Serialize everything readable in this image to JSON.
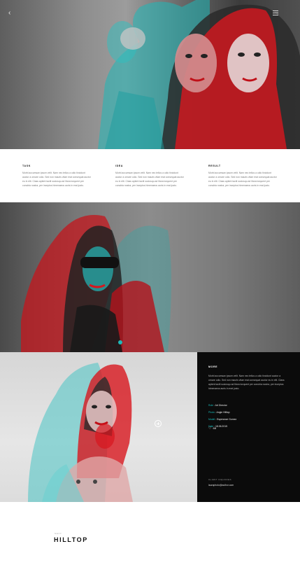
{
  "columns": [
    {
      "title": "TASK",
      "text": "Morbi accumsan ipsum velit. Nam nec tellus a odio tincidunt auctor a ornare odio. Sed non mauris vitae erat consequat auctor eu in elit. Class aptent taciti sociosqu ad litora torquent per conubia nostra, per inceptos himenaeos auris in erat justo."
    },
    {
      "title": "IDEA",
      "text": "Morbi accumsan ipsum velit. Nam nec tellus a odio tincidunt auctor a ornare odio. Sed non mauris vitae erat consequat auctor eu in elit. Class aptent taciti sociosqu ad litora torquent per conubia nostra, per inceptos himenaeos auris in erat justo."
    },
    {
      "title": "RESULT",
      "text": "Morbi accumsan ipsum velit. Nam nec tellus a odio tincidunt auctor a ornare odio. Sed non mauris vitae erat consequat auctor eu in elit. Class aptent taciti sociosqu ad litora torquent per conubia nostra, per inceptos himenaeos auris in erat justo."
    }
  ],
  "panel": {
    "title": "MORE",
    "text": "Morbi accumsan ipsum velit. Nam nec tellus a odio tincidunt auctor a ornare odio. Sed non mauris vitae erat consequat auctor eu in elit. Class aptent taciti sociosqu ad litora torquent per conubia nostra, per inceptos himenaeos auris in erat justo.",
    "info": [
      {
        "key": "Role",
        "value": "Art Director"
      },
      {
        "key": "Photo",
        "value": "Angie Hilltop"
      },
      {
        "key": "Model",
        "value": "Esperanze Gomez"
      },
      {
        "key": "Date",
        "value": "18.06.2015"
      }
    ],
    "likes": "68",
    "client_label": "CLIENT INQUIRIES",
    "client_email": "lauraphoto@author.com"
  },
  "footer": {
    "next_label": "NEXT",
    "next_title": "HILLTOP"
  },
  "colors": {
    "accent_cyan": "#19c0bf",
    "accent_red": "#d8161e",
    "panel_bg": "#0b0b0b"
  },
  "icons": {
    "back": "chevron-left-icon",
    "menu": "menu-icon",
    "plus": "plus-circle-icon",
    "like": "heart-icon"
  }
}
